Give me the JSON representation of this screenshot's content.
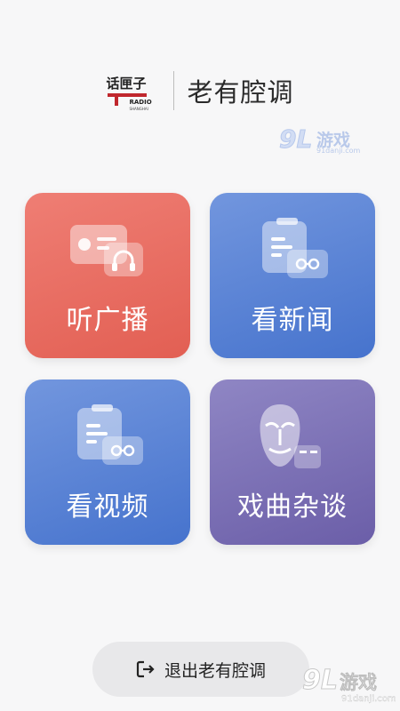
{
  "header": {
    "logo_text": "话匣子",
    "logo_radio": "RADIO",
    "logo_sub": "SHANGHAI",
    "title": "老有腔调"
  },
  "watermark_top": {
    "num": "9L",
    "text": "游戏",
    "url": "91danji.com"
  },
  "cards": [
    {
      "label": "听广播",
      "icon": "radio-headphones-icon",
      "color": "#e8685d"
    },
    {
      "label": "看新闻",
      "icon": "news-glasses-icon",
      "color": "#5a84d6"
    },
    {
      "label": "看视频",
      "icon": "video-glasses-icon",
      "color": "#5a84d6"
    },
    {
      "label": "戏曲杂谈",
      "icon": "opera-mask-icon",
      "color": "#7d71b6"
    }
  ],
  "exit": {
    "label": "退出老有腔调",
    "icon": "exit-icon"
  },
  "watermark_bottom": {
    "num": "9L",
    "text": "游戏",
    "url": "91danji.com"
  }
}
